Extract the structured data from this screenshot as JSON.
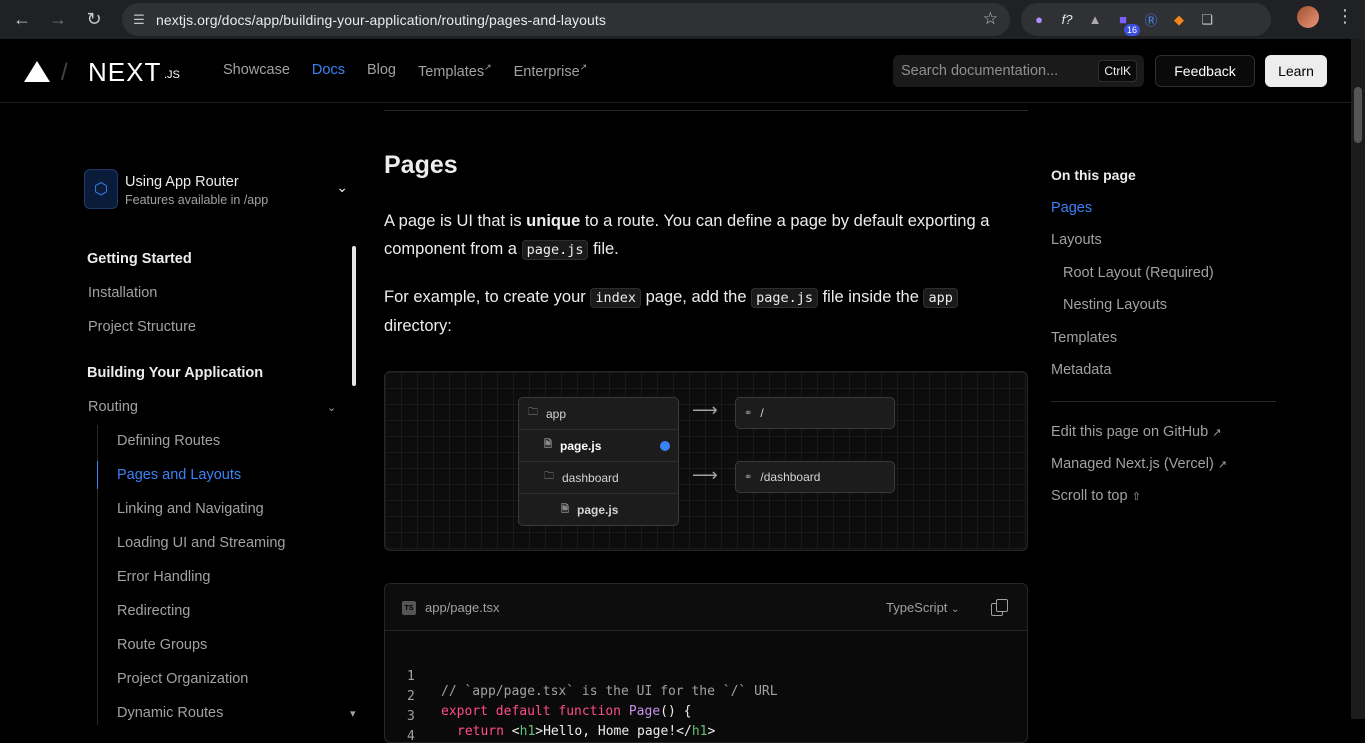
{
  "browser": {
    "url": "nextjs.org/docs/app/building-your-application/routing/pages-and-layouts",
    "extension_badge": "16"
  },
  "header": {
    "logo_text": "NEXT",
    "logo_suffix": ".JS",
    "nav": [
      {
        "label": "Showcase"
      },
      {
        "label": "Docs"
      },
      {
        "label": "Blog"
      },
      {
        "label": "Templates"
      },
      {
        "label": "Enterprise"
      }
    ],
    "search_placeholder": "Search documentation...",
    "search_shortcut": "CtrlK",
    "feedback_label": "Feedback",
    "learn_label": "Learn"
  },
  "sidebar": {
    "router_title": "Using App Router",
    "router_sub": "Features available in /app",
    "items": [
      {
        "label": "Getting Started"
      },
      {
        "label": "Installation"
      },
      {
        "label": "Project Structure"
      },
      {
        "label": "Building Your Application"
      },
      {
        "label": "Routing"
      },
      {
        "label": "Defining Routes"
      },
      {
        "label": "Pages and Layouts"
      },
      {
        "label": "Linking and Navigating"
      },
      {
        "label": "Loading UI and Streaming"
      },
      {
        "label": "Error Handling"
      },
      {
        "label": "Redirecting"
      },
      {
        "label": "Route Groups"
      },
      {
        "label": "Project Organization"
      },
      {
        "label": "Dynamic Routes"
      }
    ]
  },
  "main": {
    "heading": "Pages",
    "p1_a": "A page is UI that is ",
    "p1_bold": "unique",
    "p1_b": " to a route. You can define a page by default exporting a component from a ",
    "p1_code": "page.js",
    "p1_c": " file.",
    "p2_a": "For example, to create your ",
    "p2_code1": "index",
    "p2_b": " page, add the ",
    "p2_code2": "page.js",
    "p2_c": " file inside the ",
    "p2_code3": "app",
    "p2_d": " directory:",
    "diagram": {
      "tree": [
        "app",
        "page.js",
        "dashboard",
        "page.js"
      ],
      "routes": [
        "/",
        "/dashboard"
      ]
    },
    "code": {
      "filename": "app/page.tsx",
      "language": "TypeScript",
      "lines": [
        {
          "n": "1",
          "comment": "// `app/page.tsx` is the UI for the `/` URL"
        },
        {
          "n": "2",
          "kw": "export default function",
          "fn": "Page",
          "rest": "() {"
        },
        {
          "n": "3",
          "kw": "return",
          "t1": "<",
          "tag1": "h1",
          "t2": ">Hello, Home page!</",
          "tag2": "h1",
          "t3": ">"
        },
        {
          "n": "4",
          "rest": "}"
        }
      ]
    }
  },
  "toc": {
    "title": "On this page",
    "items": [
      {
        "label": "Pages"
      },
      {
        "label": "Layouts"
      },
      {
        "label": "Root Layout (Required)"
      },
      {
        "label": "Nesting Layouts"
      },
      {
        "label": "Templates"
      },
      {
        "label": "Metadata"
      }
    ],
    "links": [
      {
        "label": "Edit this page on GitHub"
      },
      {
        "label": "Managed Next.js (Vercel)"
      },
      {
        "label": "Scroll to top"
      }
    ]
  }
}
